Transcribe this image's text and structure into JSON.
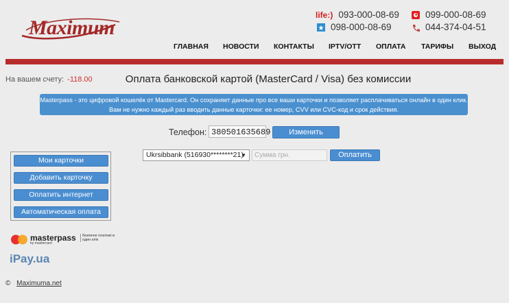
{
  "brand": {
    "logo_text": "Maximum"
  },
  "phones": {
    "life_label": "life:)",
    "life_number": "093-000-08-69",
    "vodafone_number": "099-000-08-69",
    "kyivstar_number": "098-000-08-69",
    "landline_number": "044-374-04-51"
  },
  "nav": {
    "items": [
      "ГЛАВНАЯ",
      "НОВОСТИ",
      "КОНТАКТЫ",
      "IPTV/OTT",
      "ОПЛАТА",
      "ТАРИФЫ",
      "ВЫХОД"
    ]
  },
  "account": {
    "balance_label": "На вашем счету:",
    "balance_value": "-118.00"
  },
  "page": {
    "title": "Оплата банковской картой (MasterCard / Visa) без комиссии",
    "info_line1": "Masterpass - это цифровой кошелёк от Mastercard. Он сохраняет данные про все ваши карточки и позволяет расплачиваться онлайн в один клик.",
    "info_line2": "Вам не нужно каждый раз вводить данные карточки: ее номер, CVV или CVC-код и срок действия."
  },
  "phone_form": {
    "label": "Телефон:",
    "value": "380501635689",
    "change_button": "Изменить"
  },
  "payment_form": {
    "card_selected": "Ukrsibbank (516930********21)",
    "amount_placeholder": "Сумма грн.",
    "pay_button": "Оплатить"
  },
  "sidebar": {
    "items": [
      "Мои карточки",
      "Добавить карточку",
      "Оплатить интернет",
      "Автоматическая оплата"
    ]
  },
  "badges": {
    "masterpass_text": "masterpass",
    "masterpass_sub": "by mastercard",
    "masterpass_right": "безпечні платежі в один клік",
    "ipay_text": "iPay.ua"
  },
  "footer": {
    "copyright": "©",
    "link": "Maximuma.net"
  },
  "colors": {
    "brand_red": "#b82c2c",
    "button_blue": "#4a8ed1",
    "balance_red": "#d03030"
  }
}
